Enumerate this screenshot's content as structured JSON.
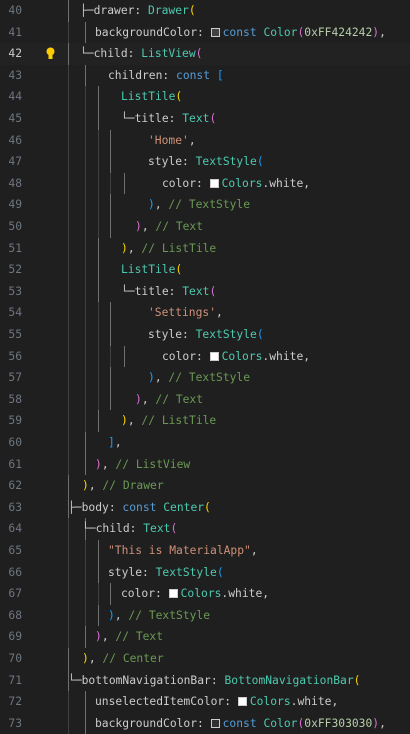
{
  "editor": {
    "active_line": 42,
    "lines": [
      {
        "n": "40",
        "tokens": [
          [
            "tree",
            "├─"
          ],
          [
            "p",
            "drawer: "
          ],
          [
            "ty",
            "Drawer"
          ],
          [
            "b1",
            "("
          ]
        ]
      },
      {
        "n": "41",
        "tokens": [
          [
            "p",
            "backgroundColor: "
          ],
          [
            "swatch",
            "#424242"
          ],
          [
            "k",
            "const "
          ],
          [
            "ty",
            "Color"
          ],
          [
            "b2",
            "("
          ],
          [
            "n",
            "0xFF424242"
          ],
          [
            "b2",
            ")"
          ],
          [
            "p",
            ","
          ]
        ]
      },
      {
        "n": "42",
        "tokens": [
          [
            "tree",
            "└─"
          ],
          [
            "p",
            "child: "
          ],
          [
            "ty",
            "ListView"
          ],
          [
            "b2",
            "("
          ]
        ]
      },
      {
        "n": "43",
        "tokens": [
          [
            "p",
            "children: "
          ],
          [
            "k",
            "const "
          ],
          [
            "b3",
            "["
          ]
        ]
      },
      {
        "n": "44",
        "tokens": [
          [
            "ty",
            "ListTile"
          ],
          [
            "b1",
            "("
          ]
        ]
      },
      {
        "n": "45",
        "tokens": [
          [
            "tree",
            "└─"
          ],
          [
            "p",
            "title: "
          ],
          [
            "ty",
            "Text"
          ],
          [
            "b2",
            "("
          ]
        ]
      },
      {
        "n": "46",
        "tokens": [
          [
            "s",
            "'Home'"
          ],
          [
            "p",
            ","
          ]
        ]
      },
      {
        "n": "47",
        "tokens": [
          [
            "p",
            "style: "
          ],
          [
            "ty",
            "TextStyle"
          ],
          [
            "b3",
            "("
          ]
        ]
      },
      {
        "n": "48",
        "tokens": [
          [
            "p",
            "color: "
          ],
          [
            "swatch",
            "#ffffff"
          ],
          [
            "ty",
            "Colors"
          ],
          [
            "p",
            "."
          ],
          [
            "p",
            "white"
          ],
          [
            "p",
            ","
          ]
        ]
      },
      {
        "n": "49",
        "tokens": [
          [
            "b3",
            ")"
          ],
          [
            "p",
            ", "
          ],
          [
            "c",
            "// TextStyle"
          ]
        ]
      },
      {
        "n": "50",
        "tokens": [
          [
            "b2",
            ")"
          ],
          [
            "p",
            ", "
          ],
          [
            "c",
            "// Text"
          ]
        ]
      },
      {
        "n": "51",
        "tokens": [
          [
            "b1",
            ")"
          ],
          [
            "p",
            ", "
          ],
          [
            "c",
            "// ListTile"
          ]
        ]
      },
      {
        "n": "52",
        "tokens": [
          [
            "ty",
            "ListTile"
          ],
          [
            "b1",
            "("
          ]
        ]
      },
      {
        "n": "53",
        "tokens": [
          [
            "tree",
            "└─"
          ],
          [
            "p",
            "title: "
          ],
          [
            "ty",
            "Text"
          ],
          [
            "b2",
            "("
          ]
        ]
      },
      {
        "n": "54",
        "tokens": [
          [
            "s",
            "'Settings'"
          ],
          [
            "p",
            ","
          ]
        ]
      },
      {
        "n": "55",
        "tokens": [
          [
            "p",
            "style: "
          ],
          [
            "ty",
            "TextStyle"
          ],
          [
            "b3",
            "("
          ]
        ]
      },
      {
        "n": "56",
        "tokens": [
          [
            "p",
            "color: "
          ],
          [
            "swatch",
            "#ffffff"
          ],
          [
            "ty",
            "Colors"
          ],
          [
            "p",
            "."
          ],
          [
            "p",
            "white"
          ],
          [
            "p",
            ","
          ]
        ]
      },
      {
        "n": "57",
        "tokens": [
          [
            "b3",
            ")"
          ],
          [
            "p",
            ", "
          ],
          [
            "c",
            "// TextStyle"
          ]
        ]
      },
      {
        "n": "58",
        "tokens": [
          [
            "b2",
            ")"
          ],
          [
            "p",
            ", "
          ],
          [
            "c",
            "// Text"
          ]
        ]
      },
      {
        "n": "59",
        "tokens": [
          [
            "b1",
            ")"
          ],
          [
            "p",
            ", "
          ],
          [
            "c",
            "// ListTile"
          ]
        ]
      },
      {
        "n": "60",
        "tokens": [
          [
            "b3",
            "]"
          ],
          [
            "p",
            ","
          ]
        ]
      },
      {
        "n": "61",
        "tokens": [
          [
            "b2",
            ")"
          ],
          [
            "p",
            ", "
          ],
          [
            "c",
            "// ListView"
          ]
        ]
      },
      {
        "n": "62",
        "tokens": [
          [
            "b1",
            ")"
          ],
          [
            "p",
            ", "
          ],
          [
            "c",
            "// Drawer"
          ]
        ]
      },
      {
        "n": "63",
        "tokens": [
          [
            "tree",
            "├─"
          ],
          [
            "p",
            "body: "
          ],
          [
            "k",
            "const "
          ],
          [
            "ty",
            "Center"
          ],
          [
            "b1",
            "("
          ]
        ]
      },
      {
        "n": "64",
        "tokens": [
          [
            "tree",
            "└─"
          ],
          [
            "p",
            "child: "
          ],
          [
            "ty",
            "Text"
          ],
          [
            "b2",
            "("
          ]
        ]
      },
      {
        "n": "65",
        "tokens": [
          [
            "s",
            "\"This is MaterialApp\""
          ],
          [
            "p",
            ","
          ]
        ]
      },
      {
        "n": "66",
        "tokens": [
          [
            "p",
            "style: "
          ],
          [
            "ty",
            "TextStyle"
          ],
          [
            "b3",
            "("
          ]
        ]
      },
      {
        "n": "67",
        "tokens": [
          [
            "p",
            "color: "
          ],
          [
            "swatch",
            "#ffffff"
          ],
          [
            "ty",
            "Colors"
          ],
          [
            "p",
            "."
          ],
          [
            "p",
            "white"
          ],
          [
            "p",
            ","
          ]
        ]
      },
      {
        "n": "68",
        "tokens": [
          [
            "b3",
            ")"
          ],
          [
            "p",
            ", "
          ],
          [
            "c",
            "// TextStyle"
          ]
        ]
      },
      {
        "n": "69",
        "tokens": [
          [
            "b2",
            ")"
          ],
          [
            "p",
            ", "
          ],
          [
            "c",
            "// Text"
          ]
        ]
      },
      {
        "n": "70",
        "tokens": [
          [
            "b1",
            ")"
          ],
          [
            "p",
            ", "
          ],
          [
            "c",
            "// Center"
          ]
        ]
      },
      {
        "n": "71",
        "tokens": [
          [
            "tree",
            "└─"
          ],
          [
            "p",
            "bottomNavigationBar: "
          ],
          [
            "ty",
            "BottomNavigationBar"
          ],
          [
            "b1",
            "("
          ]
        ]
      },
      {
        "n": "72",
        "tokens": [
          [
            "p",
            "unselectedItemColor: "
          ],
          [
            "swatch",
            "#ffffff"
          ],
          [
            "ty",
            "Colors"
          ],
          [
            "p",
            "."
          ],
          [
            "p",
            "white"
          ],
          [
            "p",
            ","
          ]
        ]
      },
      {
        "n": "73",
        "tokens": [
          [
            "p",
            "backgroundColor: "
          ],
          [
            "swatch",
            "#303030"
          ],
          [
            "k",
            "const "
          ],
          [
            "ty",
            "Color"
          ],
          [
            "b2",
            "("
          ],
          [
            "n",
            "0xFF303030"
          ],
          [
            "b2",
            ")"
          ],
          [
            "p",
            ","
          ]
        ]
      }
    ]
  }
}
